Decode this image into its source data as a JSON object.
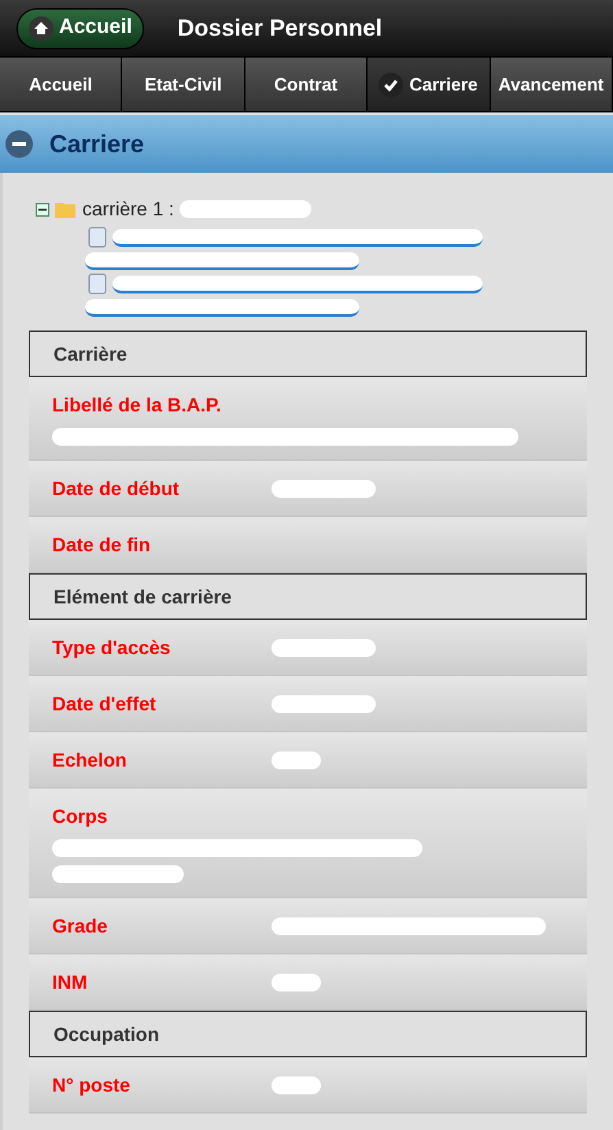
{
  "header": {
    "home_button": "Accueil",
    "title": "Dossier Personnel"
  },
  "tabs": [
    {
      "label": "Accueil",
      "selected": false
    },
    {
      "label": "Etat-Civil",
      "selected": false
    },
    {
      "label": "Contrat",
      "selected": false
    },
    {
      "label": "Carriere",
      "selected": true
    },
    {
      "label": "Avancement",
      "selected": false
    }
  ],
  "panel": {
    "title": "Carriere",
    "expanded": true
  },
  "tree": {
    "label": "carrière 1 :",
    "masked": [
      {
        "kind": "short"
      }
    ],
    "expanded": true,
    "children": [
      {
        "masked": [
          {
            "kind": "long"
          },
          {
            "kind": "medium"
          }
        ]
      },
      {
        "masked": [
          {
            "kind": "long"
          },
          {
            "kind": "medium"
          }
        ]
      }
    ]
  },
  "sections": [
    {
      "title": "Carrière",
      "rows": [
        {
          "label": "Libellé de la B.A.P.",
          "kind": "stacked",
          "masked": [
            {
              "kind": "xlong"
            }
          ]
        },
        {
          "label": "Date de début",
          "kind": "inline",
          "masked": [
            {
              "kind": "small"
            }
          ]
        },
        {
          "label": "Date de fin",
          "kind": "inline"
        }
      ]
    },
    {
      "title": "Elément de carrière",
      "rows": [
        {
          "label": "Type d'accès",
          "kind": "inline",
          "masked": [
            {
              "kind": "small"
            }
          ]
        },
        {
          "label": "Date d'effet",
          "kind": "inline",
          "masked": [
            {
              "kind": "small"
            }
          ]
        },
        {
          "label": "Echelon",
          "kind": "inline",
          "masked": [
            {
              "kind": "tiny"
            }
          ]
        },
        {
          "label": "Corps",
          "kind": "stacked",
          "masked": [
            {
              "kind": "long"
            },
            {
              "kind": "short"
            }
          ]
        },
        {
          "label": "Grade",
          "kind": "inline",
          "masked": [
            {
              "kind": "medium"
            }
          ]
        },
        {
          "label": "INM",
          "kind": "inline",
          "masked": [
            {
              "kind": "tiny"
            }
          ]
        }
      ]
    },
    {
      "title": "Occupation",
      "rows": [
        {
          "label": "N° poste",
          "kind": "inline",
          "masked": [
            {
              "kind": "tiny"
            }
          ]
        }
      ]
    }
  ]
}
